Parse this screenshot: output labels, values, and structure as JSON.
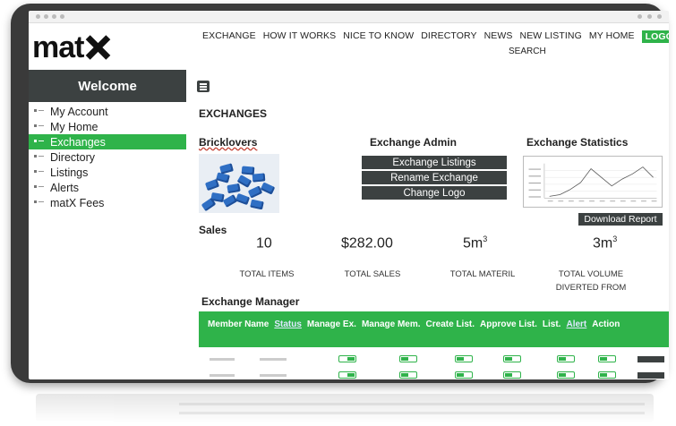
{
  "nav": {
    "items": [
      "EXCHANGE",
      "HOW IT WORKS",
      "NICE TO KNOW",
      "DIRECTORY",
      "NEWS",
      "NEW LISTING",
      "MY HOME"
    ],
    "logout": "LOGOUT",
    "search": "SEARCH"
  },
  "logo": {
    "text": "mat"
  },
  "sidebar": {
    "welcome": "Welcome",
    "items": [
      {
        "label": "My Account",
        "active": false
      },
      {
        "label": "My Home",
        "active": false
      },
      {
        "label": "Exchanges",
        "active": true
      },
      {
        "label": "Directory",
        "active": false
      },
      {
        "label": "Listings",
        "active": false
      },
      {
        "label": "Alerts",
        "active": false
      },
      {
        "label": "matX Fees",
        "active": false
      }
    ]
  },
  "main": {
    "section_title": "EXCHANGES",
    "exchange_name": "Bricklovers",
    "admin": {
      "title": "Exchange Admin",
      "buttons": [
        "Exchange Listings",
        "Rename Exchange",
        "Change Logo"
      ]
    },
    "stats": {
      "title": "Exchange Statistics",
      "download": "Download Report"
    },
    "sales": {
      "label": "Sales",
      "items": [
        {
          "value": "10",
          "unit_sup": "",
          "label1": "TOTAL ITEMS",
          "label2": ""
        },
        {
          "value": "$282.00",
          "unit_sup": "",
          "label1": "TOTAL SALES",
          "label2": ""
        },
        {
          "value": "5m",
          "unit_sup": "3",
          "label1": "TOTAL MATERIL",
          "label2": ""
        },
        {
          "value": "3m",
          "unit_sup": "3",
          "label1": "TOTAL VOLUME",
          "label2": "DIVERTED FROM"
        }
      ]
    },
    "manager": {
      "title": "Exchange Manager",
      "columns": [
        "Member Name",
        "Status",
        "Manage Ex.",
        "Manage Mem.",
        "Create List.",
        "Approve List.",
        "List.",
        "Alert",
        "Action"
      ]
    }
  },
  "colors": {
    "green": "#2fb34a",
    "dark": "#3c4141",
    "frame": "#3a3a3a"
  }
}
